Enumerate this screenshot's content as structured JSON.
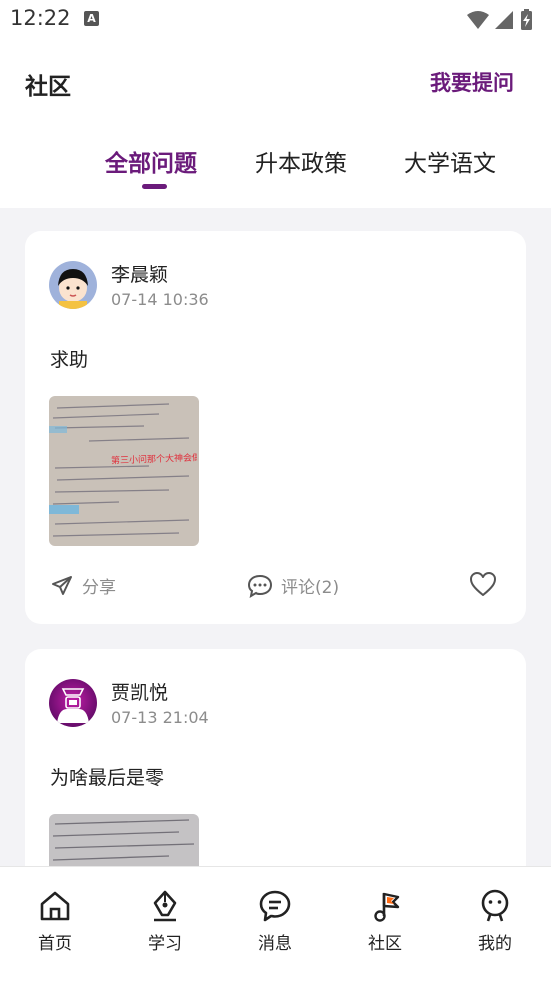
{
  "status_bar": {
    "time": "12:22",
    "notification_badge": "A"
  },
  "header": {
    "title": "社区",
    "action": "我要提问"
  },
  "tabs": [
    {
      "label": "全部问题",
      "active": true
    },
    {
      "label": "升本政策",
      "active": false
    },
    {
      "label": "大学语文",
      "active": false
    }
  ],
  "posts": [
    {
      "username": "李晨颖",
      "timestamp": "07-14 10:36",
      "text": "求助",
      "image_caption": "第三小问那个大神会做啊",
      "actions": {
        "share": "分享",
        "comment": "评论(2)"
      }
    },
    {
      "username": "贾凯悦",
      "timestamp": "07-13 21:04",
      "text": "为啥最后是零"
    }
  ],
  "bottom_nav": [
    {
      "label": "首页",
      "icon": "home-icon"
    },
    {
      "label": "学习",
      "icon": "pen-icon"
    },
    {
      "label": "消息",
      "icon": "message-icon"
    },
    {
      "label": "社区",
      "icon": "community-icon"
    },
    {
      "label": "我的",
      "icon": "profile-icon"
    }
  ],
  "colors": {
    "accent": "#6b1b7b",
    "text": "#222222",
    "muted": "#8c8c8c",
    "background": "#f3f3f6"
  }
}
